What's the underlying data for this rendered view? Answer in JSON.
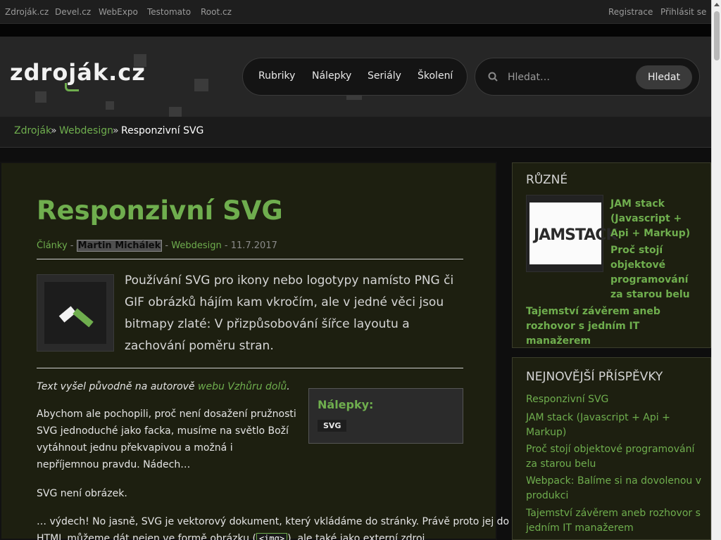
{
  "topbar": {
    "sites": [
      "Zdroják.cz",
      "Devel.cz",
      "WebExpo",
      "Testomato",
      "Root.cz"
    ],
    "register": "Registrace",
    "login": "Přihlásit se"
  },
  "header": {
    "logo": "zdroják.cz",
    "nav": [
      "Rubriky",
      "Nálepky",
      "Seriály",
      "Školení"
    ],
    "search_placeholder": "Hledat…",
    "search_button": "Hledat"
  },
  "breadcrumb": {
    "home": "Zdroják",
    "sep": "»",
    "section": "Webdesign",
    "current": "Responzivní SVG"
  },
  "article": {
    "title": "Responzivní SVG",
    "meta": {
      "category": "Články",
      "dash": "-",
      "author": "Martin Michálek",
      "section": "Webdesign",
      "date": "11.7.2017"
    },
    "perex": "Používání SVG pro ikony nebo logotypy namísto PNG či GIF obrázků hájím kam vkročím, ale v jedné věci jsou bitmapy zlaté: V přizpůsobování šířce layoutu a zachování poměru stran.",
    "source_prefix": "Text vyšel původně na autorově ",
    "source_link": "webu Vzhůru dolů",
    "source_suffix": ".",
    "tags_heading": "Nálepky:",
    "tag": "SVG",
    "para1": "Abychom ale pochopili, proč není dosažení pružnosti SVG jednoduché jako facka, musíme na světlo Boží vytáhnout jednu překvapivou a možná i nepříjemnou pravdu. Nádech…",
    "para2": "SVG není obrázek.",
    "para3_a": "… výdech! No jasně, SVG je vektorový dokument, který vkládáme do stránky. Právě proto jej do",
    "para3_b": "HTML můžeme dát nejen ve formě obrázku (",
    "para3_code": "<img>",
    "para3_c": "), ale také jako externí zdroj"
  },
  "sidebar": {
    "misc_heading": "RŮZNÉ",
    "jam_image_text": "JAMSTACK",
    "misc_links": [
      "JAM stack (Javascript + Api + Markup)",
      "Proč stojí objektové programování za starou belu",
      "Tajemství závěrem aneb rozhovor s jedním IT manažerem"
    ],
    "latest_heading": "NEJNOVĚJŠÍ PŘÍSPĚVKY",
    "latest_links": [
      "Responzivní SVG",
      "JAM stack (Javascript + Api + Markup)",
      "Proč stojí objektové programování za starou belu",
      "Webpack: Balíme si na dovolenou v produkci",
      "Tajemství závěrem aneb rozhovor s jedním IT manažerem"
    ]
  }
}
